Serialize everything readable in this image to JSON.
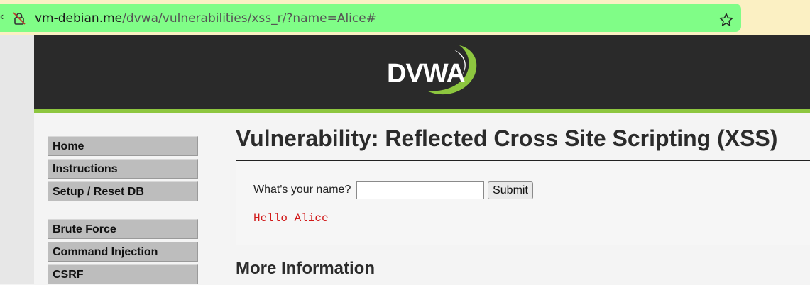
{
  "browser": {
    "url_host": "vm-debian.me",
    "url_path": "/dvwa/vulnerabilities/xss_r/?name=Alice#",
    "icons": [
      "lock-icon",
      "star-icon"
    ],
    "colors": {
      "address_bar": "#80fd87",
      "chrome_bg": "#fbf0c3"
    }
  },
  "header": {
    "logo_text": "DVWA",
    "colors": {
      "background": "#2a2a2a",
      "accent": "#8dc63f"
    }
  },
  "menu": {
    "items": [
      {
        "label": "Home"
      },
      {
        "label": "Instructions"
      },
      {
        "label": "Setup / Reset DB"
      },
      {
        "label": "Brute Force"
      },
      {
        "label": "Command Injection"
      },
      {
        "label": "CSRF"
      }
    ]
  },
  "main": {
    "title": "Vulnerability: Reflected Cross Site Scripting (XSS)",
    "form": {
      "label": "What's your name?",
      "input_value": "",
      "submit_label": "Submit"
    },
    "output": "Hello Alice",
    "output_color": "#d11a1a",
    "more_info_heading": "More Information"
  }
}
